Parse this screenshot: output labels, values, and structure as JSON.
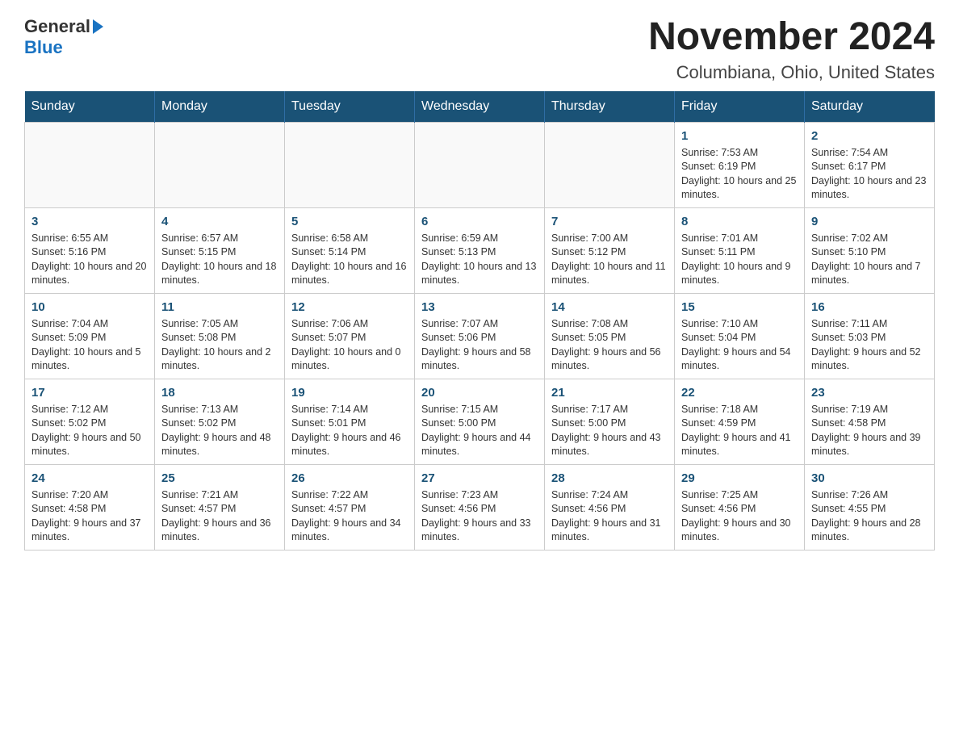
{
  "logo": {
    "general": "General",
    "blue": "Blue"
  },
  "title": "November 2024",
  "subtitle": "Columbiana, Ohio, United States",
  "days_of_week": [
    "Sunday",
    "Monday",
    "Tuesday",
    "Wednesday",
    "Thursday",
    "Friday",
    "Saturday"
  ],
  "weeks": [
    [
      {
        "day": "",
        "sunrise": "",
        "sunset": "",
        "daylight": ""
      },
      {
        "day": "",
        "sunrise": "",
        "sunset": "",
        "daylight": ""
      },
      {
        "day": "",
        "sunrise": "",
        "sunset": "",
        "daylight": ""
      },
      {
        "day": "",
        "sunrise": "",
        "sunset": "",
        "daylight": ""
      },
      {
        "day": "",
        "sunrise": "",
        "sunset": "",
        "daylight": ""
      },
      {
        "day": "1",
        "sunrise": "Sunrise: 7:53 AM",
        "sunset": "Sunset: 6:19 PM",
        "daylight": "Daylight: 10 hours and 25 minutes."
      },
      {
        "day": "2",
        "sunrise": "Sunrise: 7:54 AM",
        "sunset": "Sunset: 6:17 PM",
        "daylight": "Daylight: 10 hours and 23 minutes."
      }
    ],
    [
      {
        "day": "3",
        "sunrise": "Sunrise: 6:55 AM",
        "sunset": "Sunset: 5:16 PM",
        "daylight": "Daylight: 10 hours and 20 minutes."
      },
      {
        "day": "4",
        "sunrise": "Sunrise: 6:57 AM",
        "sunset": "Sunset: 5:15 PM",
        "daylight": "Daylight: 10 hours and 18 minutes."
      },
      {
        "day": "5",
        "sunrise": "Sunrise: 6:58 AM",
        "sunset": "Sunset: 5:14 PM",
        "daylight": "Daylight: 10 hours and 16 minutes."
      },
      {
        "day": "6",
        "sunrise": "Sunrise: 6:59 AM",
        "sunset": "Sunset: 5:13 PM",
        "daylight": "Daylight: 10 hours and 13 minutes."
      },
      {
        "day": "7",
        "sunrise": "Sunrise: 7:00 AM",
        "sunset": "Sunset: 5:12 PM",
        "daylight": "Daylight: 10 hours and 11 minutes."
      },
      {
        "day": "8",
        "sunrise": "Sunrise: 7:01 AM",
        "sunset": "Sunset: 5:11 PM",
        "daylight": "Daylight: 10 hours and 9 minutes."
      },
      {
        "day": "9",
        "sunrise": "Sunrise: 7:02 AM",
        "sunset": "Sunset: 5:10 PM",
        "daylight": "Daylight: 10 hours and 7 minutes."
      }
    ],
    [
      {
        "day": "10",
        "sunrise": "Sunrise: 7:04 AM",
        "sunset": "Sunset: 5:09 PM",
        "daylight": "Daylight: 10 hours and 5 minutes."
      },
      {
        "day": "11",
        "sunrise": "Sunrise: 7:05 AM",
        "sunset": "Sunset: 5:08 PM",
        "daylight": "Daylight: 10 hours and 2 minutes."
      },
      {
        "day": "12",
        "sunrise": "Sunrise: 7:06 AM",
        "sunset": "Sunset: 5:07 PM",
        "daylight": "Daylight: 10 hours and 0 minutes."
      },
      {
        "day": "13",
        "sunrise": "Sunrise: 7:07 AM",
        "sunset": "Sunset: 5:06 PM",
        "daylight": "Daylight: 9 hours and 58 minutes."
      },
      {
        "day": "14",
        "sunrise": "Sunrise: 7:08 AM",
        "sunset": "Sunset: 5:05 PM",
        "daylight": "Daylight: 9 hours and 56 minutes."
      },
      {
        "day": "15",
        "sunrise": "Sunrise: 7:10 AM",
        "sunset": "Sunset: 5:04 PM",
        "daylight": "Daylight: 9 hours and 54 minutes."
      },
      {
        "day": "16",
        "sunrise": "Sunrise: 7:11 AM",
        "sunset": "Sunset: 5:03 PM",
        "daylight": "Daylight: 9 hours and 52 minutes."
      }
    ],
    [
      {
        "day": "17",
        "sunrise": "Sunrise: 7:12 AM",
        "sunset": "Sunset: 5:02 PM",
        "daylight": "Daylight: 9 hours and 50 minutes."
      },
      {
        "day": "18",
        "sunrise": "Sunrise: 7:13 AM",
        "sunset": "Sunset: 5:02 PM",
        "daylight": "Daylight: 9 hours and 48 minutes."
      },
      {
        "day": "19",
        "sunrise": "Sunrise: 7:14 AM",
        "sunset": "Sunset: 5:01 PM",
        "daylight": "Daylight: 9 hours and 46 minutes."
      },
      {
        "day": "20",
        "sunrise": "Sunrise: 7:15 AM",
        "sunset": "Sunset: 5:00 PM",
        "daylight": "Daylight: 9 hours and 44 minutes."
      },
      {
        "day": "21",
        "sunrise": "Sunrise: 7:17 AM",
        "sunset": "Sunset: 5:00 PM",
        "daylight": "Daylight: 9 hours and 43 minutes."
      },
      {
        "day": "22",
        "sunrise": "Sunrise: 7:18 AM",
        "sunset": "Sunset: 4:59 PM",
        "daylight": "Daylight: 9 hours and 41 minutes."
      },
      {
        "day": "23",
        "sunrise": "Sunrise: 7:19 AM",
        "sunset": "Sunset: 4:58 PM",
        "daylight": "Daylight: 9 hours and 39 minutes."
      }
    ],
    [
      {
        "day": "24",
        "sunrise": "Sunrise: 7:20 AM",
        "sunset": "Sunset: 4:58 PM",
        "daylight": "Daylight: 9 hours and 37 minutes."
      },
      {
        "day": "25",
        "sunrise": "Sunrise: 7:21 AM",
        "sunset": "Sunset: 4:57 PM",
        "daylight": "Daylight: 9 hours and 36 minutes."
      },
      {
        "day": "26",
        "sunrise": "Sunrise: 7:22 AM",
        "sunset": "Sunset: 4:57 PM",
        "daylight": "Daylight: 9 hours and 34 minutes."
      },
      {
        "day": "27",
        "sunrise": "Sunrise: 7:23 AM",
        "sunset": "Sunset: 4:56 PM",
        "daylight": "Daylight: 9 hours and 33 minutes."
      },
      {
        "day": "28",
        "sunrise": "Sunrise: 7:24 AM",
        "sunset": "Sunset: 4:56 PM",
        "daylight": "Daylight: 9 hours and 31 minutes."
      },
      {
        "day": "29",
        "sunrise": "Sunrise: 7:25 AM",
        "sunset": "Sunset: 4:56 PM",
        "daylight": "Daylight: 9 hours and 30 minutes."
      },
      {
        "day": "30",
        "sunrise": "Sunrise: 7:26 AM",
        "sunset": "Sunset: 4:55 PM",
        "daylight": "Daylight: 9 hours and 28 minutes."
      }
    ]
  ]
}
